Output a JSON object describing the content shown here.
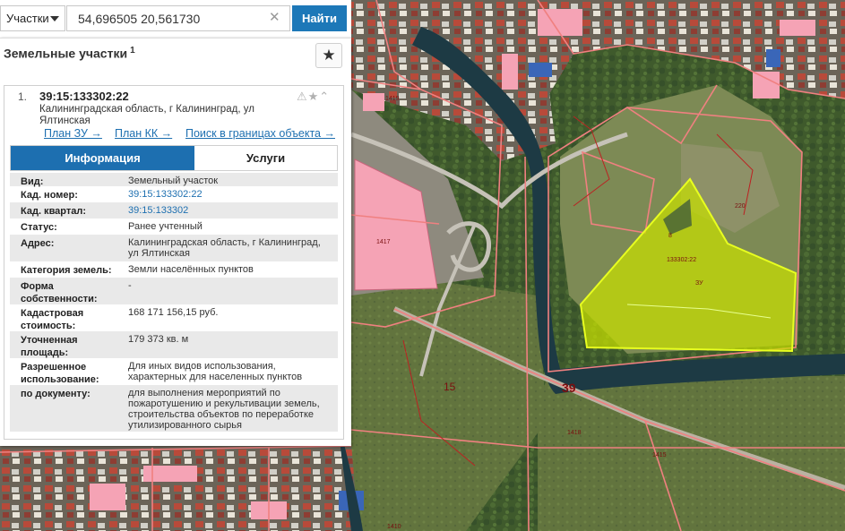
{
  "search": {
    "type_label": "Участки",
    "query": "54,696505 20,561730",
    "clear_symbol": "✕",
    "button_label": "Найти"
  },
  "panel": {
    "title": "Земельные участки",
    "title_sup": "1",
    "favorite_symbol": "★"
  },
  "card": {
    "index": "1.",
    "cad_number": "39:15:133302:22",
    "address": "Калининградская область, г Калининград, ул Ялтинская",
    "icons": "⚠★⌃",
    "links": [
      "План ЗУ →",
      "План КК →",
      "Поиск в границах объекта →"
    ],
    "tabs": [
      "Информация",
      "Услуги"
    ]
  },
  "info": [
    {
      "key": "Вид:",
      "value": "Земельный участок"
    },
    {
      "key": "Кад. номер:",
      "value": "39:15:133302:22"
    },
    {
      "key": "Кад. квартал:",
      "value": "39:15:133302"
    },
    {
      "key": "Статус:",
      "value": "Ранее учтенный"
    },
    {
      "key": "Адрес:",
      "value": "Калининградская область, г Калининград, ул Ялтинская"
    },
    {
      "key": "Категория земель:",
      "value": "Земли населённых пунктов"
    },
    {
      "key": "Форма собственности:",
      "value": "-"
    },
    {
      "key": "Кадастровая стоимость:",
      "value": "168 171 156,15 руб."
    },
    {
      "key": "Уточненная площадь:",
      "value": "179 373 кв. м"
    },
    {
      "key": "Разрешенное использование:",
      "value": "Для иных видов использования, характерных для населенных пунктов"
    },
    {
      "key": "по документу:",
      "value": "для выполнения мероприятий по пожаротушению и рекультивации земель, строительства объектов по переработке утилизированного сырья"
    }
  ],
  "map": {
    "labels": [
      "39",
      "15",
      "133302:22",
      "ЗУ",
      "8",
      "1419",
      "1417",
      "1418",
      "220",
      "1415",
      "1410"
    ],
    "colors": {
      "highlight": "#c8e000",
      "boundary": "#f08080",
      "river": "#1d3a44",
      "building_pink": "#f5a3b5"
    }
  }
}
